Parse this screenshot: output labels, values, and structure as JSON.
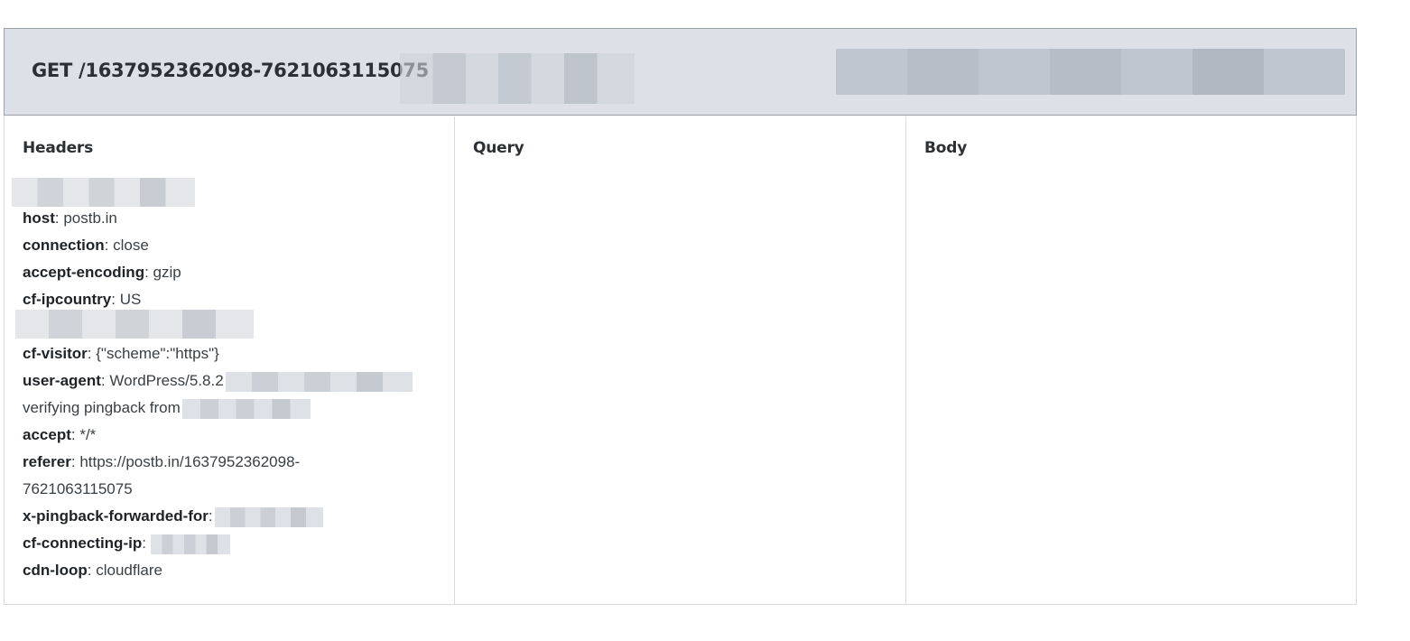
{
  "request": {
    "title": "GET /1637952362098-7621063115075"
  },
  "columns": {
    "headers_title": "Headers",
    "query_title": "Query",
    "body_title": "Body"
  },
  "headers": [
    {
      "key": "host",
      "value": "postb.in"
    },
    {
      "key": "connection",
      "value": "close"
    },
    {
      "key": "accept-encoding",
      "value": "gzip"
    },
    {
      "key": "cf-ipcountry",
      "value": "US"
    },
    {
      "key": "cf-visitor",
      "value": "{\"scheme\":\"https\"}"
    },
    {
      "key": "user-agent",
      "value": "WordPress/5.8.2"
    },
    {
      "key": "",
      "value": "verifying pingback from"
    },
    {
      "key": "accept",
      "value": "*/*"
    },
    {
      "key": "referer",
      "value": "https://postb.in/1637952362098-"
    },
    {
      "key": "",
      "value": "7621063115075"
    },
    {
      "key": "x-pingback-forwarded-for",
      "value": ""
    },
    {
      "key": "cf-connecting-ip",
      "value": ""
    },
    {
      "key": "cdn-loop",
      "value": "cloudflare"
    }
  ],
  "colors": {
    "header_bg": "#dde1e7",
    "border": "#d6d9dd",
    "title_text": "#2c3035"
  }
}
